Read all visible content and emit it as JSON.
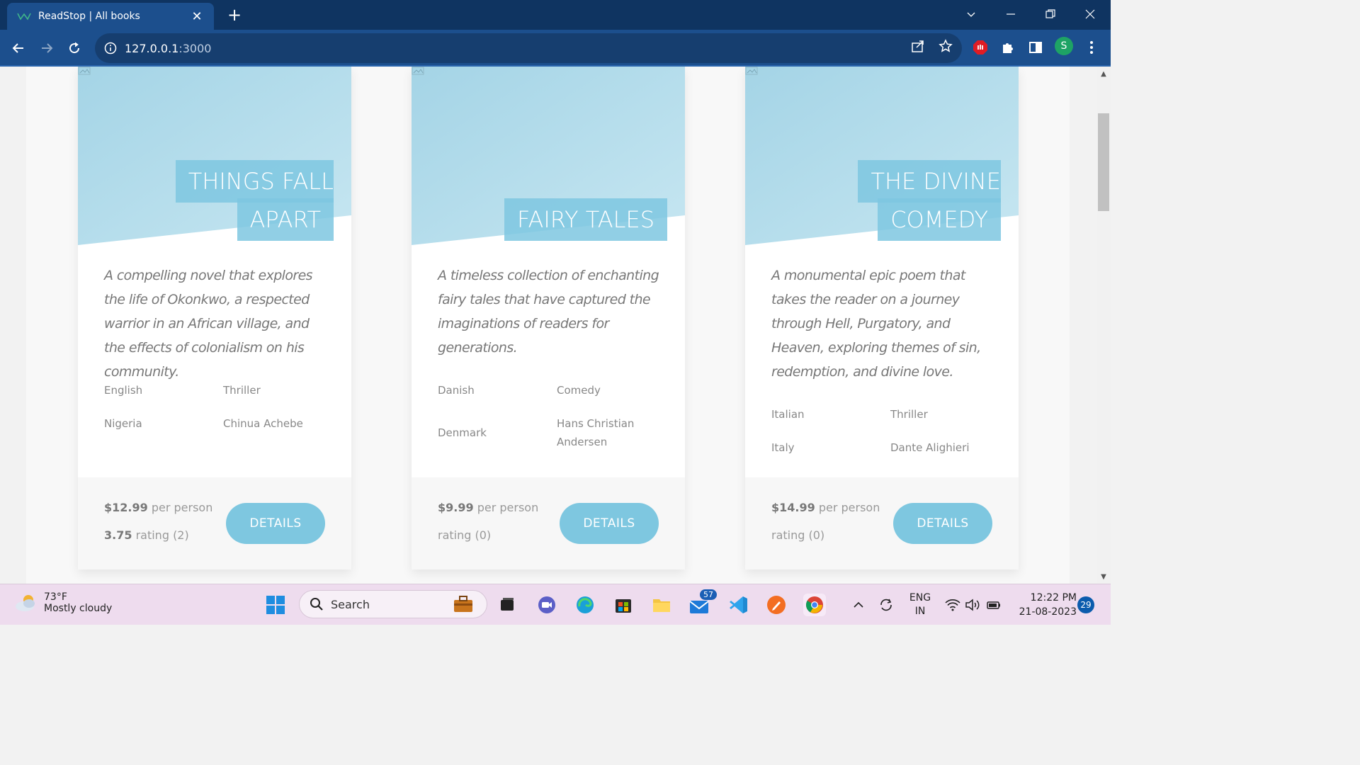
{
  "browser": {
    "tab_title": "ReadStop | All books",
    "url_host": "127.0.0.1",
    "url_port": ":3000"
  },
  "books": [
    {
      "title_line1": "THINGS FALL",
      "title_line2": "APART",
      "description": "A compelling novel that explores the life of Okonkwo, a respected warrior in an African village, and the effects of colonialism on his community.",
      "language": "English",
      "genre": "Thriller",
      "country": "Nigeria",
      "author": "Chinua Achebe",
      "price": "$12.99",
      "price_unit": "per person",
      "rating_value": "3.75",
      "rating_text": "rating (2)",
      "button": "DETAILS"
    },
    {
      "title_line1": "",
      "title_line2": "FAIRY TALES",
      "description": "A timeless collection of enchanting fairy tales that have captured the imaginations of readers for generations.",
      "language": "Danish",
      "genre": "Comedy",
      "country": "Denmark",
      "author": "Hans Christian Andersen",
      "price": "$9.99",
      "price_unit": "per person",
      "rating_value": "",
      "rating_text": "rating (0)",
      "button": "DETAILS"
    },
    {
      "title_line1": "THE DIVINE",
      "title_line2": "COMEDY",
      "description": "A monumental epic poem that takes the reader on a journey through Hell, Purgatory, and Heaven, exploring themes of sin, redemption, and divine love.",
      "language": "Italian",
      "genre": "Thriller",
      "country": "Italy",
      "author": "Dante Alighieri",
      "price": "$14.99",
      "price_unit": "per person",
      "rating_value": "",
      "rating_text": "rating (0)",
      "button": "DETAILS"
    }
  ],
  "taskbar": {
    "weather_temp": "73°F",
    "weather_cond": "Mostly cloudy",
    "search_placeholder": "Search",
    "mail_badge": "57",
    "lang_top": "ENG",
    "lang_bottom": "IN",
    "time": "12:22 PM",
    "date": "21-08-2023",
    "notifications": "29"
  },
  "colors": {
    "accent": "#7ec7e0",
    "hero_light": "#a9d8e8",
    "chrome_dark": "#0f3461",
    "chrome": "#1c4f8d"
  }
}
